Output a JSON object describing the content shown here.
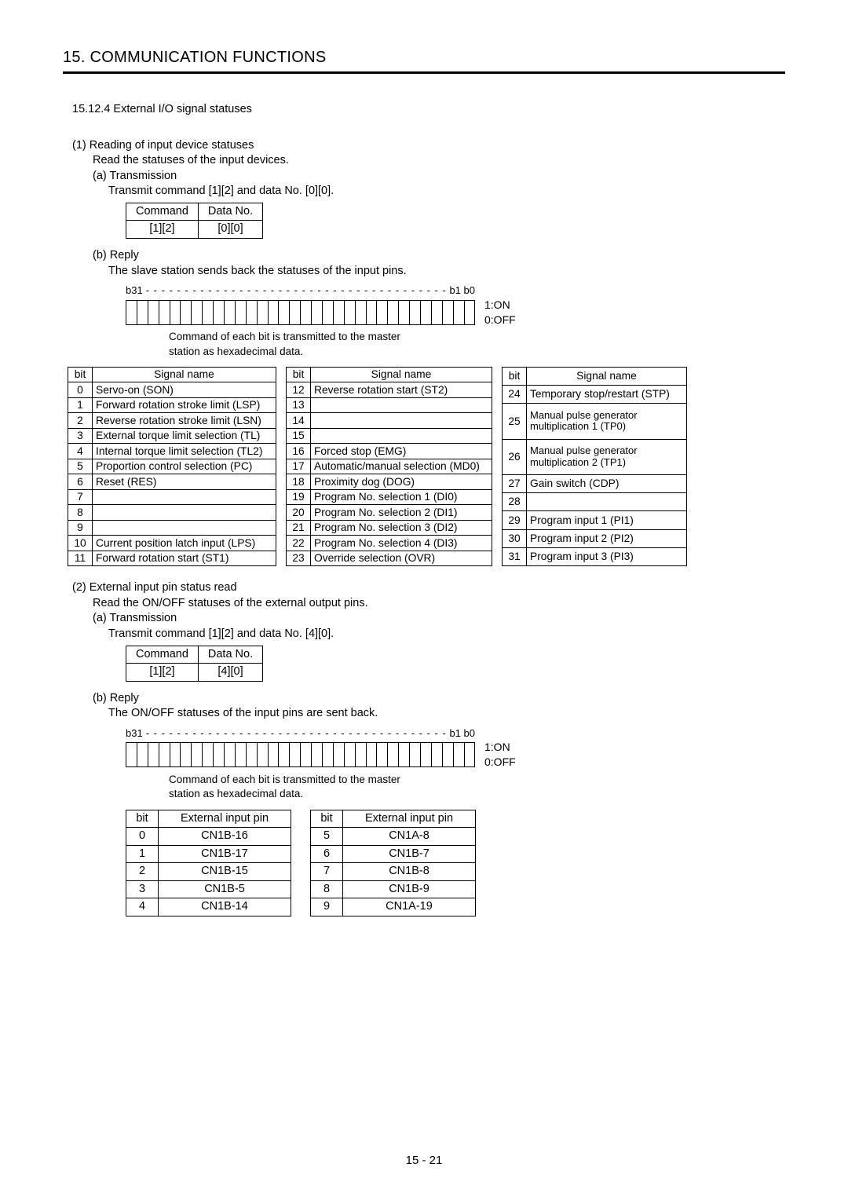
{
  "chapter": "15. COMMUNICATION FUNCTIONS",
  "section_heading": "15.12.4 External I/O signal statuses",
  "s1_title": "(1) Reading of input device statuses",
  "s1_desc": "Read the statuses of the input devices.",
  "s1a_title": "(a) Transmission",
  "s1a_desc": "Transmit command [1][2] and data No. [0][0].",
  "tbl_cmd_h1": "Command",
  "tbl_cmd_h2": "Data No.",
  "s1a_cmd": "[1][2]",
  "s1a_data": "[0][0]",
  "s1b_title": "(b) Reply",
  "s1b_desc": "The slave station sends back the statuses of the input pins.",
  "bit_b31": "b31",
  "bit_b1b0": "b1  b0",
  "bit_on": "1:ON",
  "bit_off": "0:OFF",
  "bit_note": "Command of each bit is transmitted to the master station as hexadecimal data.",
  "sig_h_bit": "bit",
  "sig_h_name": "Signal name",
  "sig1": [
    {
      "bit": "0",
      "name": "Servo-on (SON)"
    },
    {
      "bit": "1",
      "name": "Forward rotation stroke limit (LSP)"
    },
    {
      "bit": "2",
      "name": "Reverse rotation stroke limit (LSN)"
    },
    {
      "bit": "3",
      "name": "External torque limit selection (TL)"
    },
    {
      "bit": "4",
      "name": "Internal torque limit selection (TL2)"
    },
    {
      "bit": "5",
      "name": "Proportion control selection (PC)"
    },
    {
      "bit": "6",
      "name": "Reset (RES)"
    },
    {
      "bit": "7",
      "name": ""
    },
    {
      "bit": "8",
      "name": ""
    },
    {
      "bit": "9",
      "name": ""
    },
    {
      "bit": "10",
      "name": "Current position latch input (LPS)"
    },
    {
      "bit": "11",
      "name": "Forward rotation start (ST1)"
    }
  ],
  "sig2": [
    {
      "bit": "12",
      "name": "Reverse rotation start (ST2)"
    },
    {
      "bit": "13",
      "name": ""
    },
    {
      "bit": "14",
      "name": ""
    },
    {
      "bit": "15",
      "name": ""
    },
    {
      "bit": "16",
      "name": "Forced stop (EMG)"
    },
    {
      "bit": "17",
      "name": "Automatic/manual selection (MD0)"
    },
    {
      "bit": "18",
      "name": "Proximity dog (DOG)"
    },
    {
      "bit": "19",
      "name": "Program No. selection 1 (DI0)"
    },
    {
      "bit": "20",
      "name": "Program No. selection 2 (DI1)"
    },
    {
      "bit": "21",
      "name": "Program No. selection 3 (DI2)"
    },
    {
      "bit": "22",
      "name": "Program No. selection 4 (DI3)"
    },
    {
      "bit": "23",
      "name": "Override selection (OVR)"
    }
  ],
  "sig3": [
    {
      "bit": "24",
      "name": "Temporary stop/restart (STP)",
      "span": 1
    },
    {
      "bit": "25",
      "name": "Manual pulse generator multiplication 1 (TP0)",
      "span": 2
    },
    {
      "bit": "26",
      "name": "Manual pulse generator multiplication 2 (TP1)",
      "span": 2
    },
    {
      "bit": "27",
      "name": "Gain switch (CDP)",
      "span": 1
    },
    {
      "bit": "28",
      "name": "",
      "span": 1
    },
    {
      "bit": "29",
      "name": "Program input 1  (PI1)",
      "span": 1
    },
    {
      "bit": "30",
      "name": "Program input 2 (PI2)",
      "span": 1
    },
    {
      "bit": "31",
      "name": "Program input 3 (PI3)",
      "span": 1
    }
  ],
  "s2_title": "(2) External input pin status read",
  "s2_desc": "Read the ON/OFF statuses of the external output pins.",
  "s2a_title": "(a) Transmission",
  "s2a_desc": "Transmit command [1][2] and data No. [4][0].",
  "s2a_cmd": "[1][2]",
  "s2a_data": "[4][0]",
  "s2b_title": "(b) Reply",
  "s2b_desc": "The ON/OFF statuses of the input pins are sent back.",
  "pin_h_bit": "bit",
  "pin_h_name": "External input pin",
  "pin1": [
    {
      "bit": "0",
      "val": "CN1B-16"
    },
    {
      "bit": "1",
      "val": "CN1B-17"
    },
    {
      "bit": "2",
      "val": "CN1B-15"
    },
    {
      "bit": "3",
      "val": "CN1B-5"
    },
    {
      "bit": "4",
      "val": "CN1B-14"
    }
  ],
  "pin2": [
    {
      "bit": "5",
      "val": "CN1A-8"
    },
    {
      "bit": "6",
      "val": "CN1B-7"
    },
    {
      "bit": "7",
      "val": "CN1B-8"
    },
    {
      "bit": "8",
      "val": "CN1B-9"
    },
    {
      "bit": "9",
      "val": "CN1A-19"
    }
  ],
  "page_num": "15 -  21"
}
